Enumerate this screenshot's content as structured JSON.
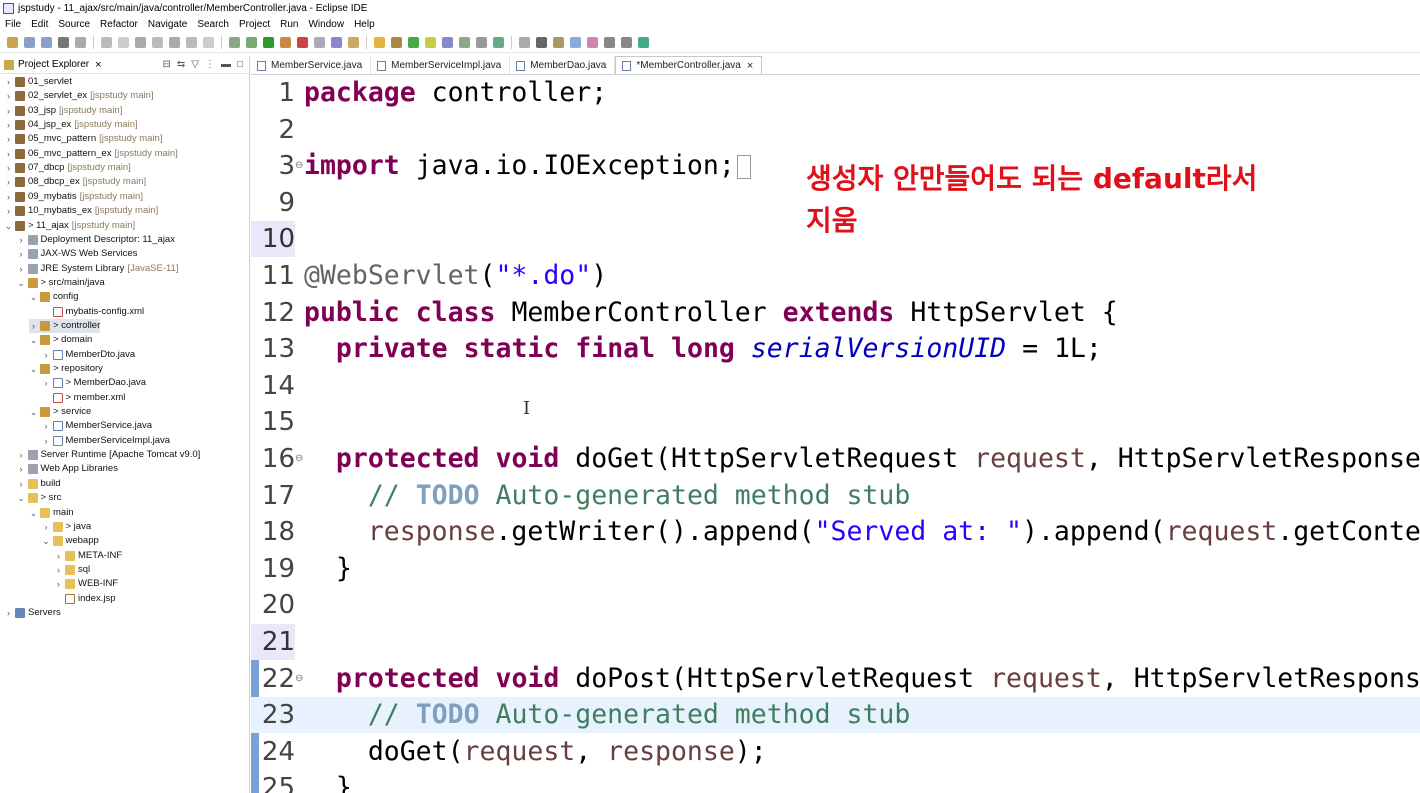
{
  "window": {
    "title": "jspstudy - 11_ajax/src/main/java/controller/MemberController.java - Eclipse IDE"
  },
  "menu": [
    "File",
    "Edit",
    "Source",
    "Refactor",
    "Navigate",
    "Search",
    "Project",
    "Run",
    "Window",
    "Help"
  ],
  "explorer": {
    "tab_label": "Project Explorer",
    "items": [
      {
        "label": "01_servlet",
        "tag": "",
        "icon": "project-icon",
        "depth": 0,
        "open": false
      },
      {
        "label": "02_servlet_ex",
        "tag": "[jspstudy main]",
        "icon": "project-icon",
        "depth": 0,
        "open": false
      },
      {
        "label": "03_jsp",
        "tag": "[jspstudy main]",
        "icon": "project-icon",
        "depth": 0,
        "open": false
      },
      {
        "label": "04_jsp_ex",
        "tag": "[jspstudy main]",
        "icon": "project-icon",
        "depth": 0,
        "open": false
      },
      {
        "label": "05_mvc_pattern",
        "tag": "[jspstudy main]",
        "icon": "project-icon",
        "depth": 0,
        "open": false
      },
      {
        "label": "06_mvc_pattern_ex",
        "tag": "[jspstudy main]",
        "icon": "project-icon",
        "depth": 0,
        "open": false
      },
      {
        "label": "07_dbcp",
        "tag": "[jspstudy main]",
        "icon": "project-icon",
        "depth": 0,
        "open": false
      },
      {
        "label": "08_dbcp_ex",
        "tag": "[jspstudy main]",
        "icon": "project-icon",
        "depth": 0,
        "open": false
      },
      {
        "label": "09_mybatis",
        "tag": "[jspstudy main]",
        "icon": "project-icon",
        "depth": 0,
        "open": false
      },
      {
        "label": "10_mybatis_ex",
        "tag": "[jspstudy main]",
        "icon": "project-icon",
        "depth": 0,
        "open": false
      },
      {
        "label": "> 11_ajax",
        "tag": "[jspstudy main]",
        "icon": "project-icon",
        "depth": 0,
        "open": true
      },
      {
        "label": "Deployment Descriptor: 11_ajax",
        "tag": "",
        "icon": "descriptor-icon",
        "depth": 1,
        "open": false
      },
      {
        "label": "JAX-WS Web Services",
        "tag": "",
        "icon": "webservice-icon",
        "depth": 1,
        "open": false
      },
      {
        "label": "JRE System Library",
        "tag": "[JavaSE-11]",
        "icon": "library-icon",
        "depth": 1,
        "open": false
      },
      {
        "label": "> src/main/java",
        "tag": "",
        "icon": "source-folder-icon",
        "depth": 1,
        "open": true
      },
      {
        "label": "config",
        "tag": "",
        "icon": "package-icon",
        "depth": 2,
        "open": true
      },
      {
        "label": "mybatis-config.xml",
        "tag": "",
        "icon": "xml-file-icon",
        "depth": 3,
        "open": null
      },
      {
        "label": "> controller",
        "tag": "",
        "icon": "package-icon",
        "depth": 2,
        "open": false
      },
      {
        "label": "> domain",
        "tag": "",
        "icon": "package-icon",
        "depth": 2,
        "open": true
      },
      {
        "label": "MemberDto.java",
        "tag": "",
        "icon": "java-file-icon",
        "depth": 3,
        "open": false
      },
      {
        "label": "> repository",
        "tag": "",
        "icon": "package-icon",
        "depth": 2,
        "open": true
      },
      {
        "label": "> MemberDao.java",
        "tag": "",
        "icon": "java-file-icon",
        "depth": 3,
        "open": false
      },
      {
        "label": "> member.xml",
        "tag": "",
        "icon": "xml-file-icon",
        "depth": 3,
        "open": null
      },
      {
        "label": "> service",
        "tag": "",
        "icon": "package-icon",
        "depth": 2,
        "open": true
      },
      {
        "label": "MemberService.java",
        "tag": "",
        "icon": "java-file-icon",
        "depth": 3,
        "open": false
      },
      {
        "label": "MemberServiceImpl.java",
        "tag": "",
        "icon": "java-file-icon",
        "depth": 3,
        "open": false
      },
      {
        "label": "Server Runtime [Apache Tomcat v9.0]",
        "tag": "",
        "icon": "library-icon",
        "depth": 1,
        "open": false
      },
      {
        "label": "Web App Libraries",
        "tag": "",
        "icon": "library-icon",
        "depth": 1,
        "open": false
      },
      {
        "label": "build",
        "tag": "",
        "icon": "folder-icon",
        "depth": 1,
        "open": false
      },
      {
        "label": "> src",
        "tag": "",
        "icon": "folder-icon",
        "depth": 1,
        "open": true
      },
      {
        "label": "main",
        "tag": "",
        "icon": "folder-icon",
        "depth": 2,
        "open": true
      },
      {
        "label": "> java",
        "tag": "",
        "icon": "folder-icon",
        "depth": 3,
        "open": false
      },
      {
        "label": "webapp",
        "tag": "",
        "icon": "folder-icon",
        "depth": 3,
        "open": true
      },
      {
        "label": "META-INF",
        "tag": "",
        "icon": "folder-icon",
        "depth": 4,
        "open": false
      },
      {
        "label": "sql",
        "tag": "",
        "icon": "folder-icon",
        "depth": 4,
        "open": false
      },
      {
        "label": "WEB-INF",
        "tag": "",
        "icon": "folder-icon",
        "depth": 4,
        "open": false
      },
      {
        "label": "index.jsp",
        "tag": "",
        "icon": "jsp-file-icon",
        "depth": 4,
        "open": null
      },
      {
        "label": "Servers",
        "tag": "",
        "icon": "server-icon",
        "depth": 0,
        "open": false
      }
    ],
    "selected_index": 17
  },
  "editor": {
    "tabs": [
      {
        "label": "MemberService.java",
        "active": false
      },
      {
        "label": "MemberServiceImpl.java",
        "active": false
      },
      {
        "label": "MemberDao.java",
        "active": false
      },
      {
        "label": "*MemberController.java",
        "active": true
      }
    ],
    "lines": [
      {
        "n": "1",
        "html": "<span class='kw'>package</span> controller;"
      },
      {
        "n": "2",
        "html": ""
      },
      {
        "n": "3",
        "html": "<span class='kw'>import</span> java.io.IOException;",
        "fold": true,
        "box": true
      },
      {
        "n": "9",
        "html": ""
      },
      {
        "n": "10",
        "html": "",
        "mark": true
      },
      {
        "n": "11",
        "html": "<span class='ann'>@WebServlet</span>(<span class='str'>\"*.do\"</span>)"
      },
      {
        "n": "12",
        "html": "<span class='kw'>public</span> <span class='kw'>class</span> MemberController <span class='kw'>extends</span> HttpServlet {"
      },
      {
        "n": "13",
        "html": "  <span class='kw'>private</span> <span class='kw'>static</span> <span class='kw'>final</span> <span class='kw'>long</span> <span class='fld'>serialVersionUID</span> = 1L;"
      },
      {
        "n": "14",
        "html": ""
      },
      {
        "n": "15",
        "html": ""
      },
      {
        "n": "16",
        "html": "  <span class='kw'>protected</span> <span class='kw'>void</span> doGet(HttpServletRequest <span class='prm'>request</span>, HttpServletResponse",
        "fold": true
      },
      {
        "n": "17",
        "html": "    <span class='cmt'>// </span><span class='todo'>TODO</span><span class='cmt'> Auto-generated method stub</span>"
      },
      {
        "n": "18",
        "html": "    <span class='prm'>response</span>.getWriter().append(<span class='str'>\"Served at: \"</span>).append(<span class='prm'>request</span>.getContex"
      },
      {
        "n": "19",
        "html": "  }"
      },
      {
        "n": "20",
        "html": ""
      },
      {
        "n": "21",
        "html": "",
        "mark": true
      },
      {
        "n": "22",
        "html": "  <span class='kw'>protected</span> <span class='kw'>void</span> doPost(HttpServletRequest <span class='prm'>request</span>, HttpServletResponse",
        "fold": true
      },
      {
        "n": "23",
        "html": "    <span class='cmt'>// </span><span class='todo'>TODO</span><span class='cmt'> Auto-generated method stub</span>",
        "current": true
      },
      {
        "n": "24",
        "html": "    doGet(<span class='prm'>request</span>, <span class='prm'>response</span>);"
      },
      {
        "n": "25",
        "html": "  }"
      }
    ]
  },
  "annotation": {
    "line1": "생성자 안만들어도 되는 default라서",
    "line2": "지움",
    "color": "#e0101a"
  }
}
